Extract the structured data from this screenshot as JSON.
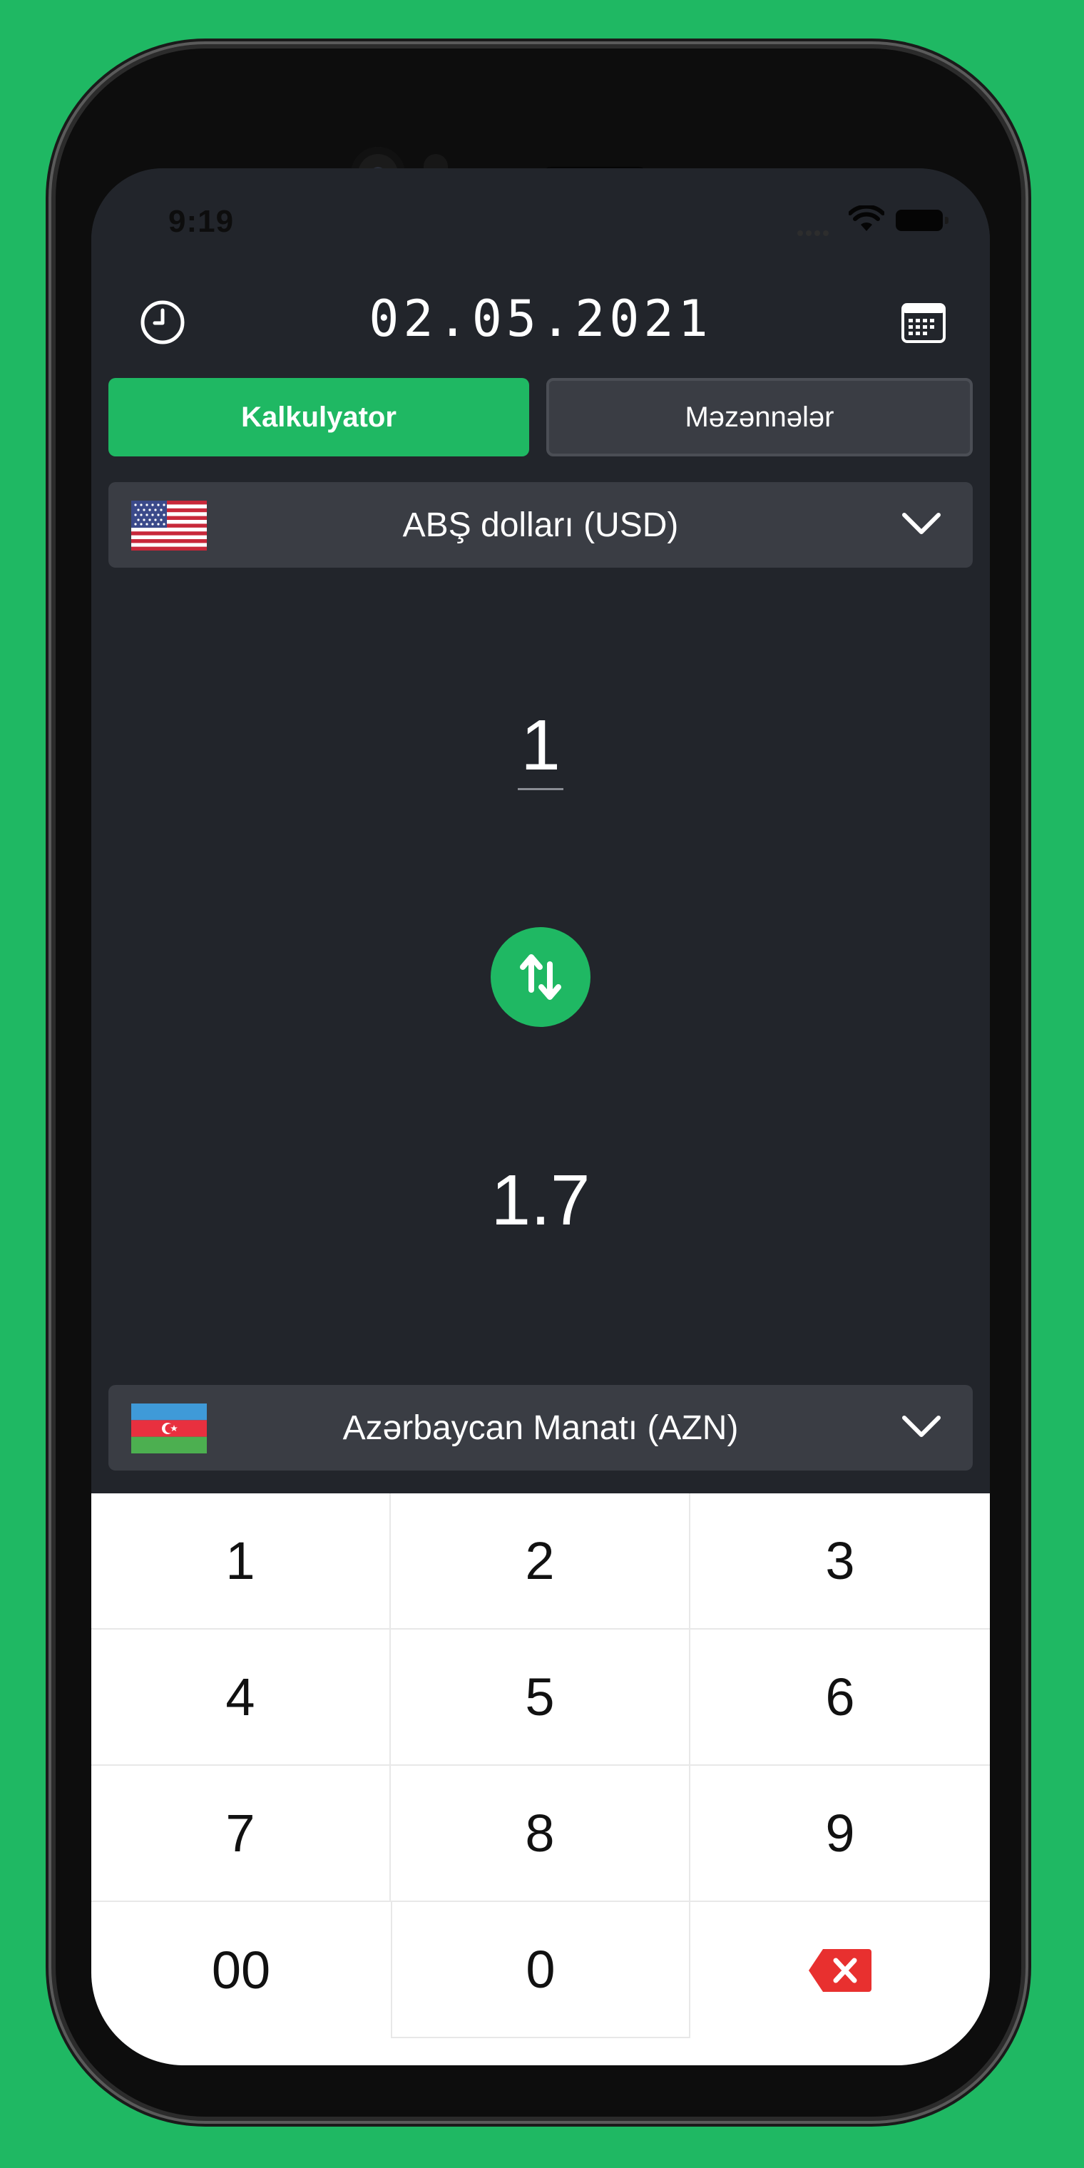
{
  "status_bar": {
    "time": "9:19"
  },
  "header": {
    "date": "02.05.2021",
    "history_icon": "clock-icon",
    "calendar_icon": "calendar-icon"
  },
  "tabs": [
    {
      "label": "Kalkulyator",
      "active": true
    },
    {
      "label": "Məzənnələr",
      "active": false
    }
  ],
  "from_currency": {
    "name": "ABŞ dolları (USD)",
    "flag": "us-flag-icon"
  },
  "amount": "1",
  "result": "1.7",
  "to_currency": {
    "name": "Azərbaycan Manatı (AZN)",
    "flag": "az-flag-icon"
  },
  "keypad": [
    "1",
    "2",
    "3",
    "4",
    "5",
    "6",
    "7",
    "8",
    "9",
    "00",
    "0"
  ],
  "colors": {
    "accent": "#1fb863",
    "background": "#22252b",
    "panel": "#3a3d44",
    "delete": "#e8302f"
  }
}
